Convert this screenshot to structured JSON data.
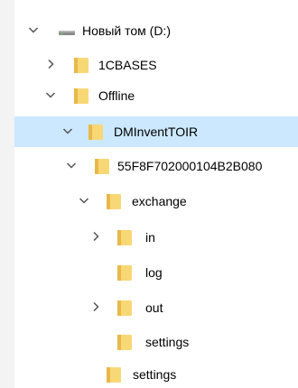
{
  "tree": {
    "drive": {
      "label": "Новый том (D:)",
      "state": "expanded",
      "icon": "drive-icon"
    },
    "items": [
      {
        "label": "1CBASES",
        "state": "collapsed",
        "icon": "folder-icon"
      },
      {
        "label": "Offline",
        "state": "expanded",
        "icon": "folder-icon"
      },
      {
        "label": "DMInventTOIR",
        "state": "expanded",
        "icon": "folder-icon",
        "selected": true
      },
      {
        "label": "55F8F702000104B2B080",
        "state": "expanded",
        "icon": "folder-icon"
      },
      {
        "label": "exchange",
        "state": "expanded",
        "icon": "folder-icon"
      },
      {
        "label": "in",
        "state": "collapsed",
        "icon": "folder-icon"
      },
      {
        "label": "log",
        "state": "leaf",
        "icon": "folder-icon"
      },
      {
        "label": "out",
        "state": "collapsed",
        "icon": "folder-icon"
      },
      {
        "label": "settings",
        "state": "leaf",
        "icon": "folder-icon"
      },
      {
        "label": "settings",
        "state": "leaf",
        "icon": "folder-icon"
      }
    ]
  },
  "colors": {
    "selection": "#cce8ff",
    "folder": "#f8d775",
    "folder_dark": "#e8b84a",
    "chevron": "#555555"
  }
}
